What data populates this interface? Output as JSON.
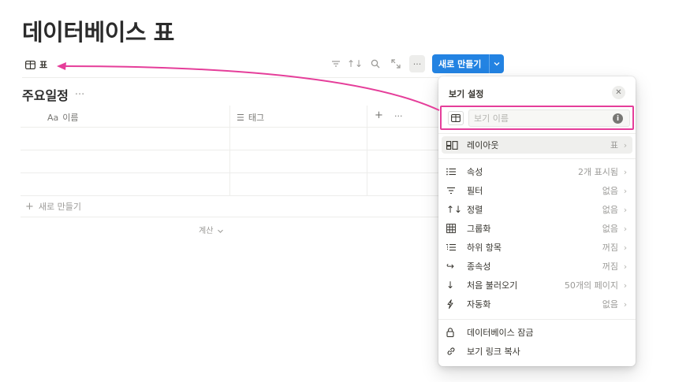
{
  "page": {
    "title": "데이터베이스 표"
  },
  "toolbar": {
    "view_tab_label": "표",
    "new_button_label": "새로 만들기",
    "more_label": "···"
  },
  "database": {
    "title": "주요일정",
    "more_label": "···",
    "columns": [
      {
        "prefix": "Aa",
        "label": "이름"
      },
      {
        "prefix": "☰",
        "label": "태그"
      }
    ],
    "add_column_label": "+",
    "column_more_label": "···",
    "add_row_label": "새로 만들기",
    "calc_label": "계산"
  },
  "view_settings": {
    "title": "보기 설정",
    "name_placeholder": "보기 이름",
    "layout": {
      "label": "레이아웃",
      "value": "표",
      "icon": "layout-icon"
    },
    "items": [
      {
        "label": "속성",
        "value": "2개 표시됨",
        "icon": "list-icon"
      },
      {
        "label": "필터",
        "value": "없음",
        "icon": "filter-icon"
      },
      {
        "label": "정렬",
        "value": "없음",
        "icon": "sort-icon"
      },
      {
        "label": "그룹화",
        "value": "없음",
        "icon": "group-icon"
      },
      {
        "label": "하위 항목",
        "value": "꺼짐",
        "icon": "sub-items-icon"
      },
      {
        "label": "종속성",
        "value": "꺼짐",
        "icon": "dependency-icon"
      },
      {
        "label": "처음 불러오기",
        "value": "50개의 페이지",
        "icon": "arrow-down-icon"
      },
      {
        "label": "자동화",
        "value": "없음",
        "icon": "lightning-icon"
      }
    ],
    "footer": [
      {
        "label": "데이터베이스 잠금",
        "icon": "lock-icon"
      },
      {
        "label": "보기 링크 복사",
        "icon": "link-icon"
      }
    ]
  },
  "colors": {
    "accent": "#2383e2",
    "highlight": "#e53e9a"
  }
}
